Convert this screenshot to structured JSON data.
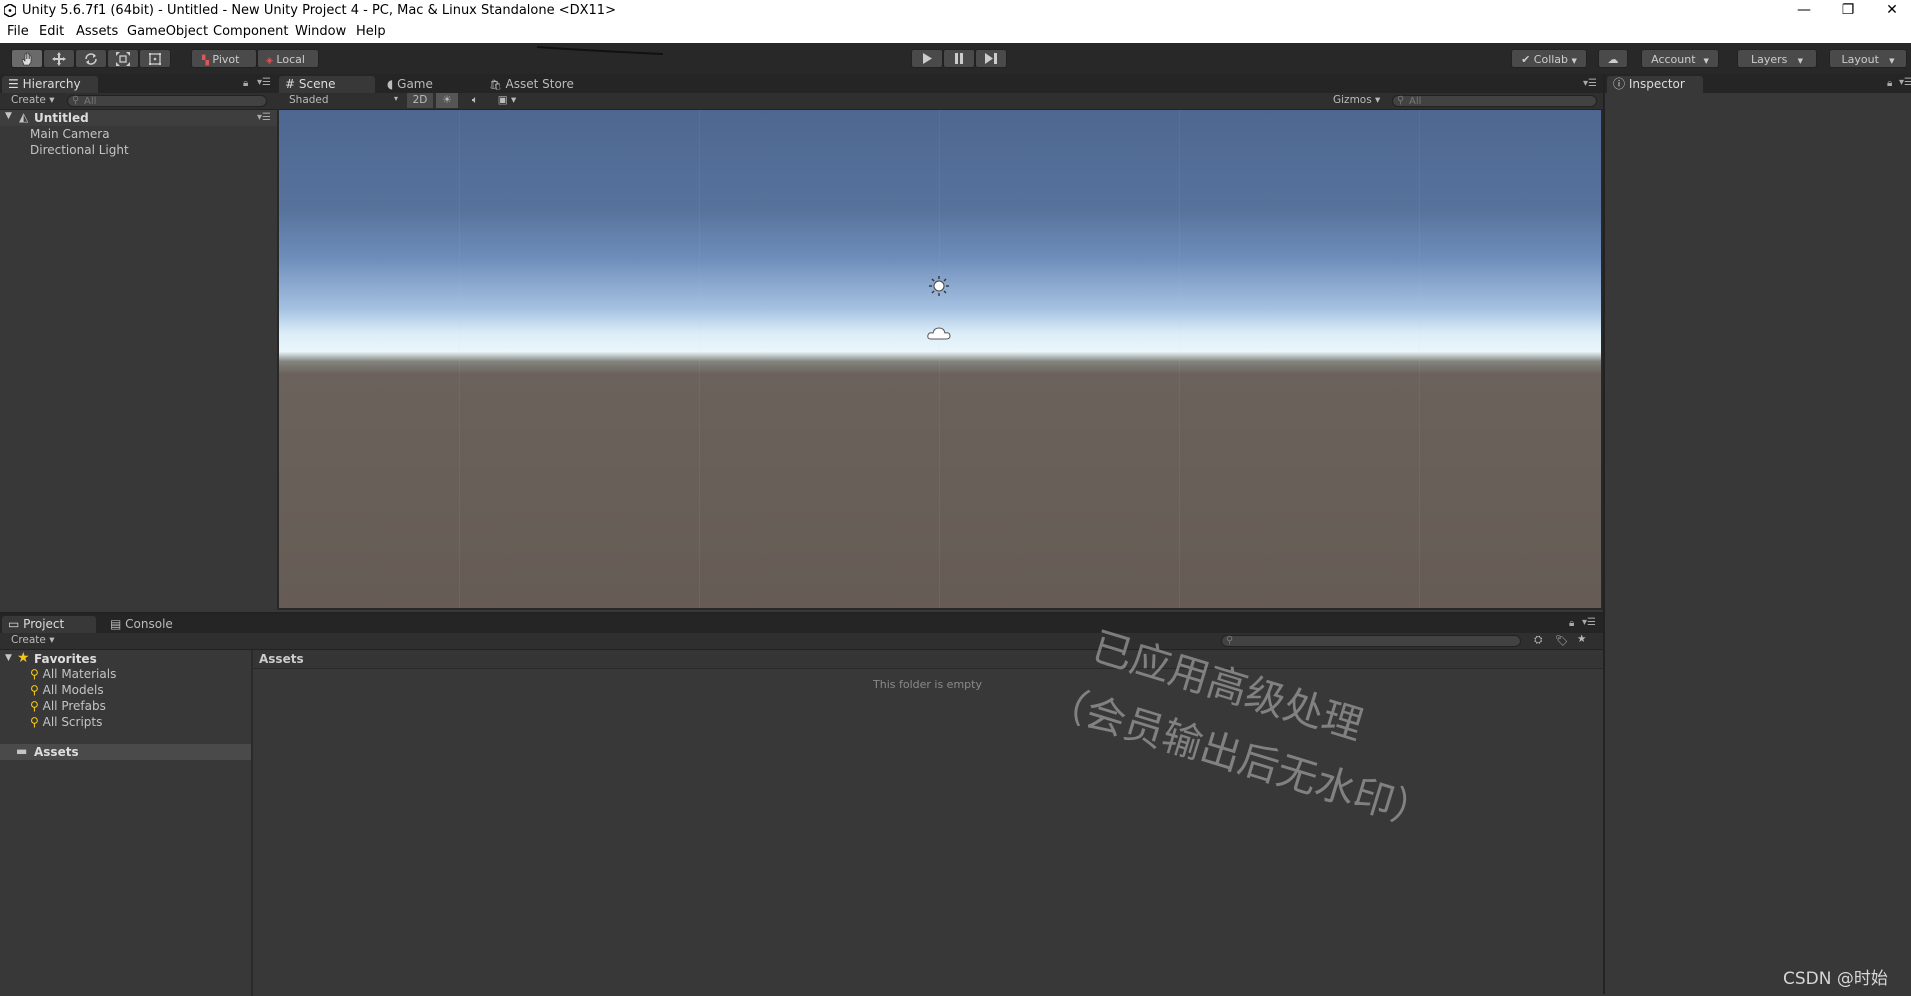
{
  "window": {
    "title": "Unity 5.6.7f1 (64bit) - Untitled - New Unity Project 4 - PC, Mac & Linux Standalone <DX11>",
    "controls": {
      "minimize": "—",
      "restore": "❐",
      "close": "✕"
    }
  },
  "menu": [
    "File",
    "Edit",
    "Assets",
    "GameObject",
    "Component",
    "Window",
    "Help"
  ],
  "toolbar": {
    "tools": [
      "hand-tool",
      "move-tool",
      "rotate-tool",
      "scale-tool",
      "rect-tool"
    ],
    "pivot_label": "Pivot",
    "local_label": "Local",
    "collab_label": "Collab",
    "account_label": "Account",
    "layers_label": "Layers",
    "layout_label": "Layout"
  },
  "hierarchy": {
    "tab": "Hierarchy",
    "create": "Create",
    "search_placeholder": "All",
    "scene_name": "Untitled",
    "items": [
      "Main Camera",
      "Directional Light"
    ]
  },
  "scene": {
    "tabs": [
      "Scene",
      "Game",
      "Asset Store"
    ],
    "draw_mode": "Shaded",
    "mode_2d": "2D",
    "gizmos": "Gizmos",
    "search_placeholder": "All"
  },
  "inspector": {
    "tab": "Inspector"
  },
  "project": {
    "tabs": [
      "Project",
      "Console"
    ],
    "create": "Create",
    "favorites_label": "Favorites",
    "favorites": [
      "All Materials",
      "All Models",
      "All Prefabs",
      "All Scripts"
    ],
    "assets_folder": "Assets",
    "breadcrumb": "Assets",
    "empty_text": "This folder is empty"
  },
  "watermark": {
    "line1": "已应用高级处理",
    "line2": "（会员输出后无水印）",
    "credit": "CSDN @时始"
  },
  "colors": {
    "toolbar_bg": "#282828",
    "panel_bg": "#383838",
    "accent_star": "#f5c518"
  }
}
